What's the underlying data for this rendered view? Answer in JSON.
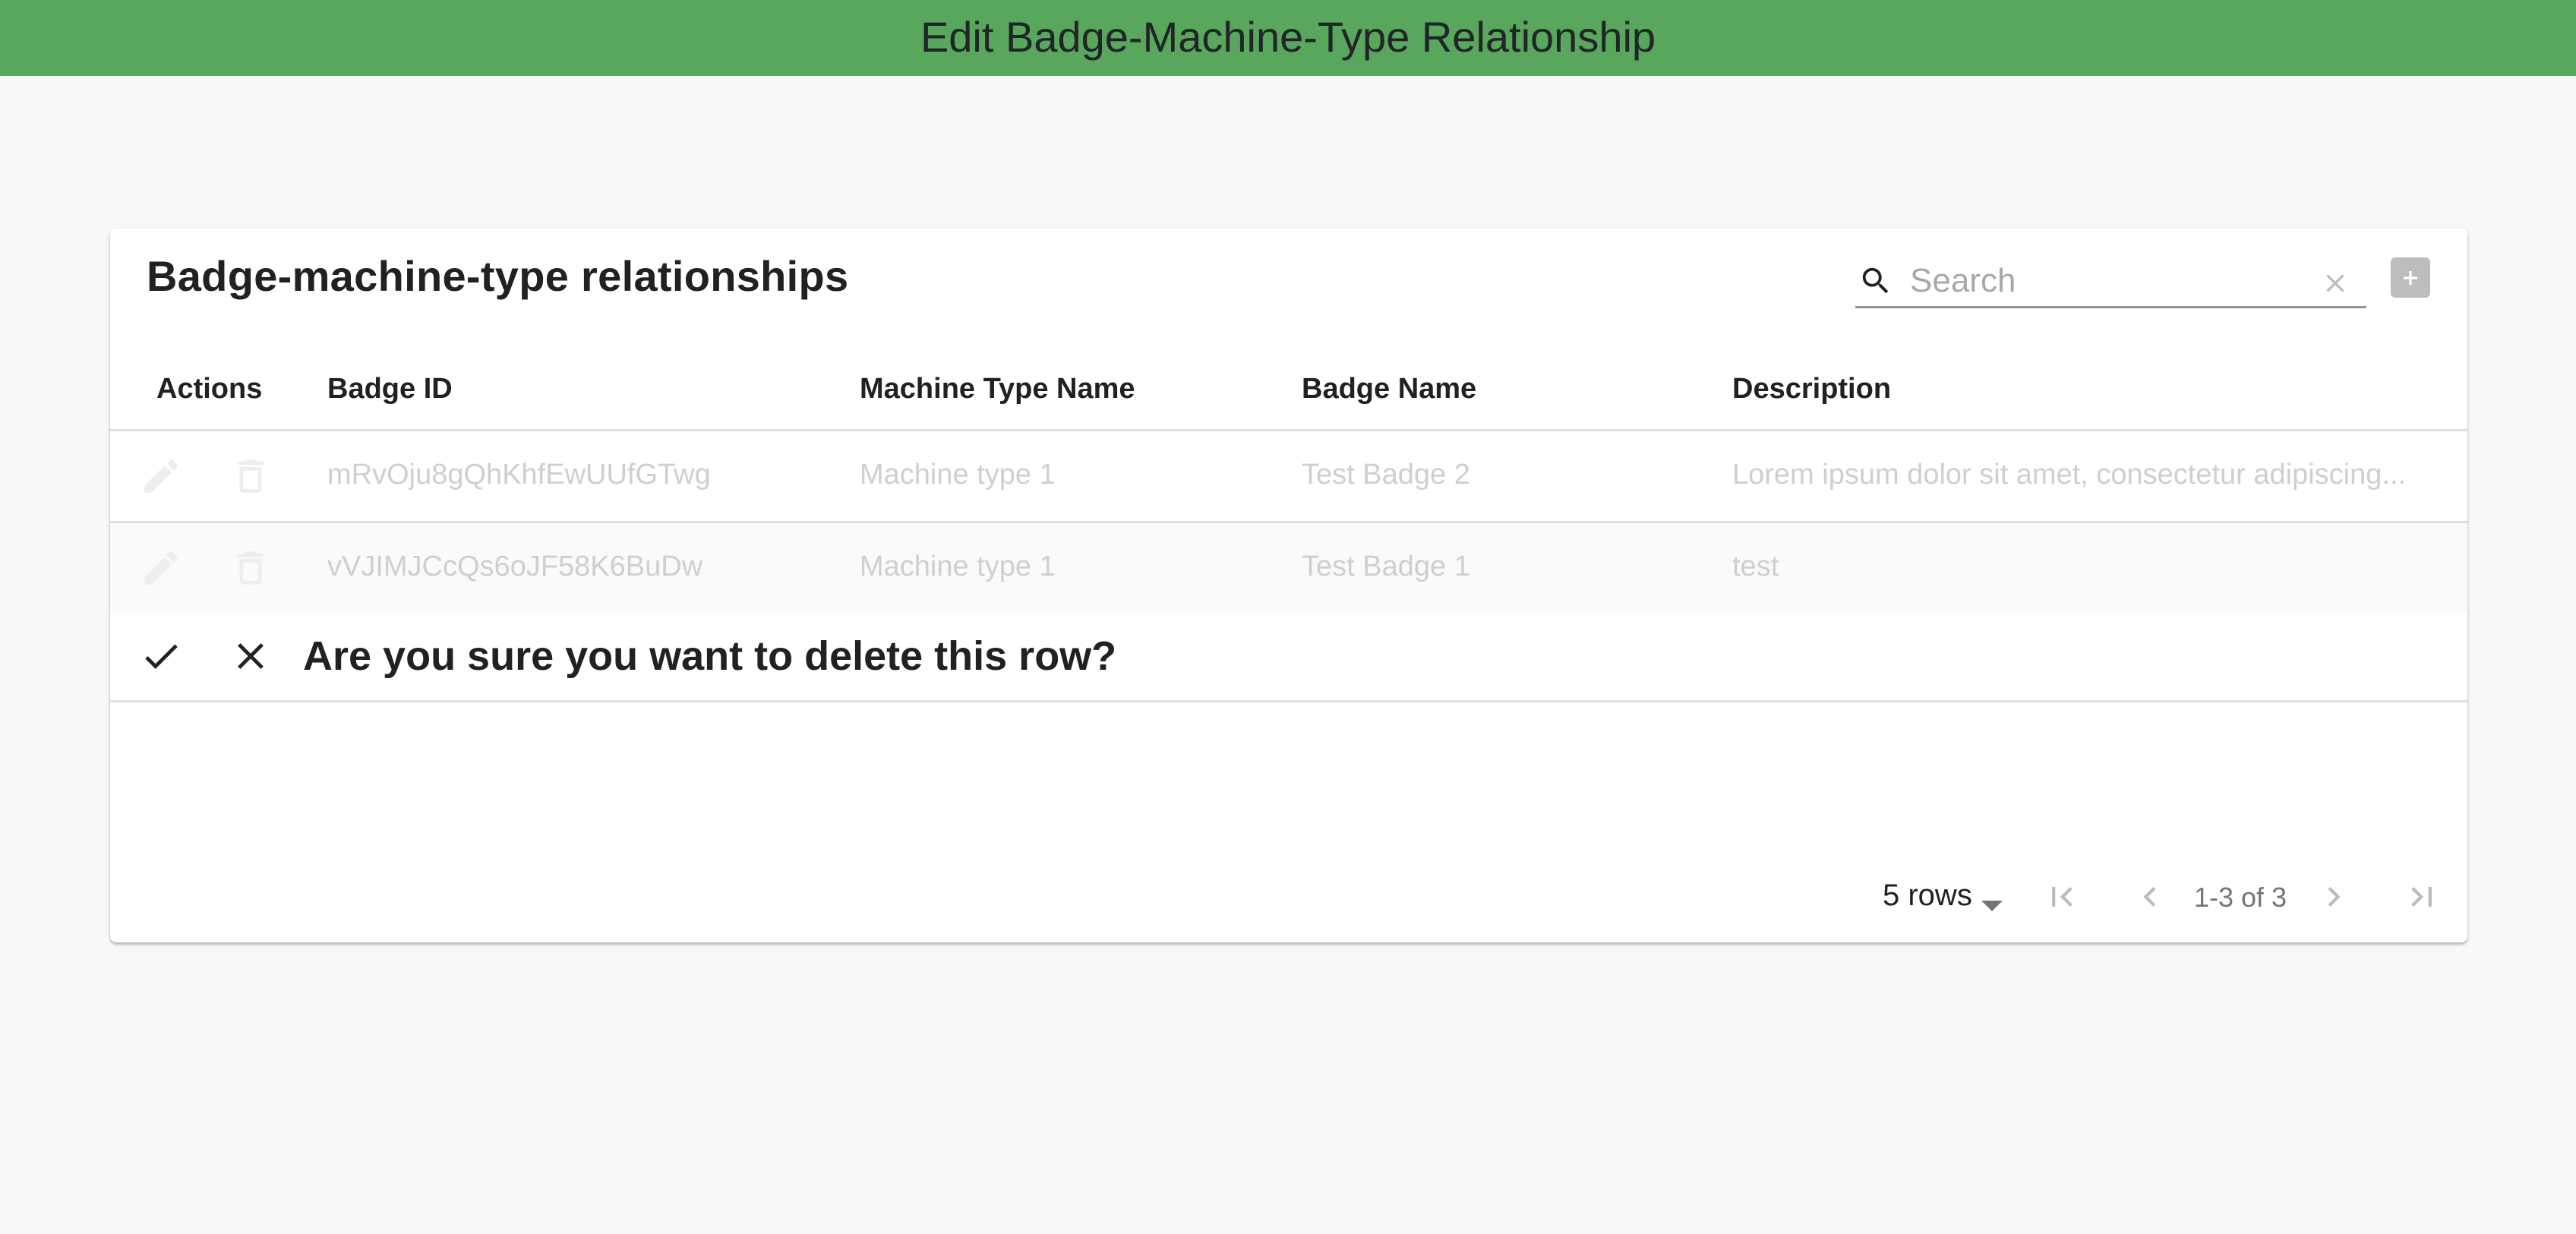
{
  "header": {
    "title": "Edit Badge-Machine-Type Relationship",
    "color": "#58a75c"
  },
  "table": {
    "title": "Badge-machine-type relationships",
    "search": {
      "placeholder": "Search",
      "value": "",
      "icon": "search-icon",
      "clear_icon": "close-icon"
    },
    "add_button_icon": "plus-icon",
    "columns": [
      "Actions",
      "Badge ID",
      "Machine Type Name",
      "Badge Name",
      "Description"
    ],
    "rows": [
      {
        "badge_id": "mRvOju8gQhKhfEwUUfGTwg",
        "machine_type_name": "Machine type 1",
        "badge_name": "Test Badge 2",
        "description": "Lorem ipsum dolor sit amet, consectetur adipiscing...",
        "actions": [
          "edit-icon",
          "delete-icon"
        ]
      },
      {
        "badge_id": "vVJIMJCcQs6oJF58K6BuDw",
        "machine_type_name": "Machine type 1",
        "badge_name": "Test Badge 1",
        "description": "test",
        "actions": [
          "edit-icon",
          "delete-icon"
        ]
      }
    ],
    "delete_confirm": {
      "message": "Are you sure you want to delete this row?",
      "confirm_icon": "check-icon",
      "cancel_icon": "close-icon"
    },
    "pagination": {
      "rows_per_page": "5 rows",
      "range": "1-3 of 3",
      "first_icon": "first-page-icon",
      "prev_icon": "chevron-left-icon",
      "next_icon": "chevron-right-icon",
      "last_icon": "last-page-icon"
    }
  }
}
